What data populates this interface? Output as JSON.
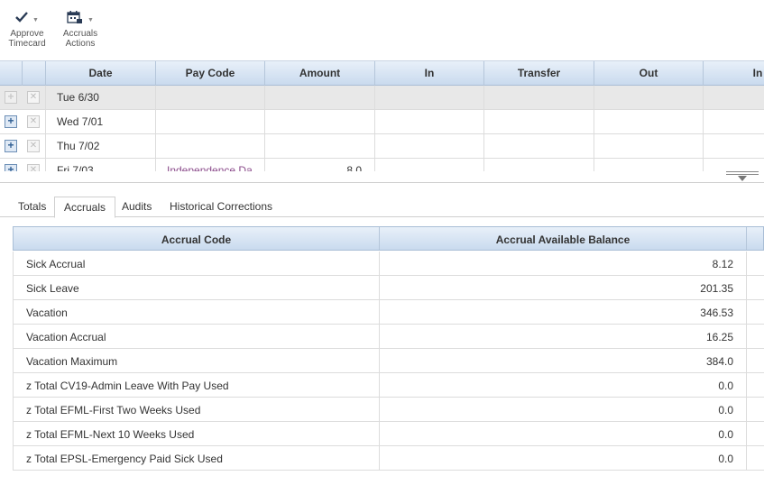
{
  "toolbar": {
    "approve": {
      "label_line1": "Approve",
      "label_line2": "Timecard",
      "icon": "checkmark-icon"
    },
    "accruals": {
      "label_line1": "Accruals",
      "label_line2": "Actions",
      "icon": "calendar-actions-icon"
    }
  },
  "grid": {
    "columns": [
      "Date",
      "Pay Code",
      "Amount",
      "In",
      "Transfer",
      "Out",
      "In"
    ],
    "rows": [
      {
        "date": "Tue 6/30",
        "pay_code": "",
        "amount": ""
      },
      {
        "date": "Wed 7/01",
        "pay_code": "",
        "amount": ""
      },
      {
        "date": "Thu 7/02",
        "pay_code": "",
        "amount": ""
      },
      {
        "date": "Fri 7/03",
        "pay_code": "Independence Da",
        "amount": "8.0"
      }
    ]
  },
  "tabs": [
    "Totals",
    "Accruals",
    "Audits",
    "Historical Corrections"
  ],
  "active_tab": "Accruals",
  "accruals": {
    "columns": [
      "Accrual Code",
      "Accrual Available Balance"
    ],
    "rows": [
      {
        "code": "Sick Accrual",
        "balance": "8.12"
      },
      {
        "code": "Sick Leave",
        "balance": "201.35"
      },
      {
        "code": "Vacation",
        "balance": "346.53"
      },
      {
        "code": "Vacation Accrual",
        "balance": "16.25"
      },
      {
        "code": "Vacation Maximum",
        "balance": "384.0"
      },
      {
        "code": "z Total CV19-Admin Leave With Pay Used",
        "balance": "0.0"
      },
      {
        "code": "z Total EFML-First Two Weeks Used",
        "balance": "0.0"
      },
      {
        "code": "z Total EFML-Next 10 Weeks Used",
        "balance": "0.0"
      },
      {
        "code": "z Total EPSL-Emergency Paid Sick Used",
        "balance": "0.0"
      }
    ]
  },
  "colors": {
    "header_gradient_top": "#e8f0f9",
    "header_gradient_bottom": "#c9daee",
    "paycode_text": "#8a4a8a",
    "selected_row": "#e8e8e8"
  }
}
